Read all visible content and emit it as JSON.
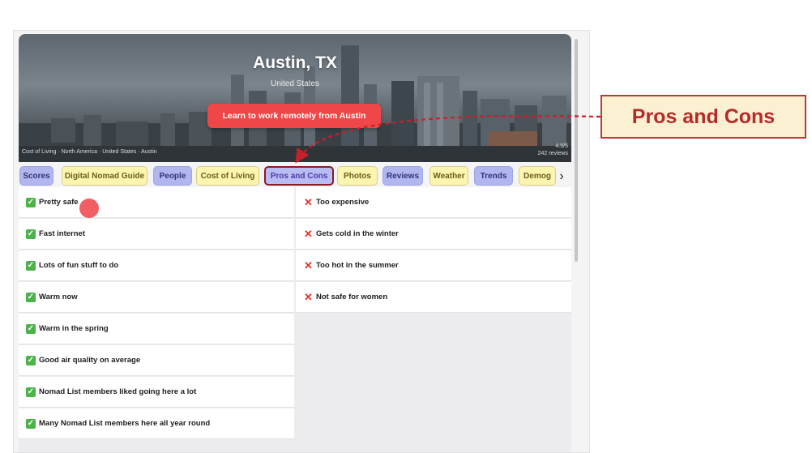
{
  "hero": {
    "city": "Austin, TX",
    "country": "United States",
    "cta_label": "Learn to work remotely from Austin",
    "caption": "Cost of Living · North America · United States · Austin",
    "count_top": "4.5/5",
    "count_bottom": "242 reviews"
  },
  "tabs": [
    {
      "label": "Scores",
      "style": "blue"
    },
    {
      "label": "Digital Nomad Guide",
      "style": "yellow"
    },
    {
      "label": "People",
      "style": "blue"
    },
    {
      "label": "Cost of Living",
      "style": "yellow"
    },
    {
      "label": "Pros and Cons",
      "style": "active"
    },
    {
      "label": "Photos",
      "style": "yellow"
    },
    {
      "label": "Reviews",
      "style": "blue"
    },
    {
      "label": "Weather",
      "style": "yellow"
    },
    {
      "label": "Trends",
      "style": "blue"
    },
    {
      "label": "Demog",
      "style": "yellow"
    }
  ],
  "pros": [
    "Pretty safe",
    "Fast internet",
    "Lots of fun stuff to do",
    "Warm now",
    "Warm in the spring",
    "Good air quality on average",
    "Nomad List members liked going here a lot",
    "Many Nomad List members here all year round"
  ],
  "cons": [
    "Too expensive",
    "Gets cold in the winter",
    "Too hot in the summer",
    "Not safe for women"
  ],
  "callout": {
    "label": "Pros and Cons"
  },
  "icons": {
    "pro": "check-icon",
    "con": "cross-icon",
    "tabs_next": "chevron-right-icon"
  },
  "colors": {
    "cta": "#ef4747",
    "callout_border": "#b83a3a",
    "callout_text": "#b52b2b",
    "pro_check": "#4cb24a",
    "con_cross": "#e0322d"
  }
}
